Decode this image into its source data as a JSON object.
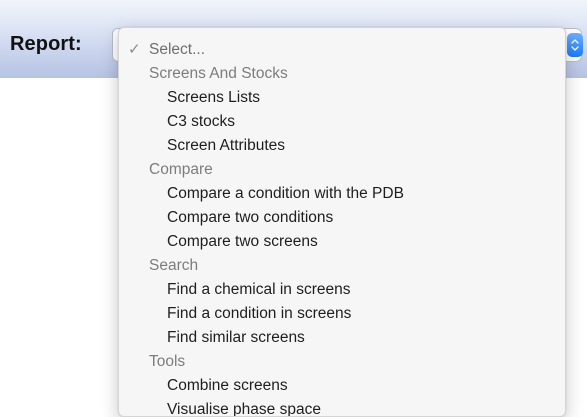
{
  "page": {
    "label": "Report:"
  },
  "dropdown": {
    "selected_label": "Select...",
    "check_icon": "✓",
    "groups": [
      {
        "header": "Screens And Stocks",
        "options": [
          "Screens Lists",
          "C3 stocks",
          "Screen Attributes"
        ]
      },
      {
        "header": "Compare",
        "options": [
          "Compare a condition with the PDB",
          "Compare two conditions",
          "Compare two screens"
        ]
      },
      {
        "header": "Search",
        "options": [
          "Find a chemical in screens",
          "Find a condition in screens",
          "Find similar screens"
        ]
      },
      {
        "header": "Tools",
        "options": [
          "Combine screens",
          "Visualise phase space"
        ]
      }
    ]
  },
  "colors": {
    "accent": "#1c7dff",
    "header_text": "#7d7d7d",
    "item_text": "#1e1e1e"
  },
  "icons": {
    "checkmark": "check-icon",
    "stepper": "select-stepper-icon"
  }
}
